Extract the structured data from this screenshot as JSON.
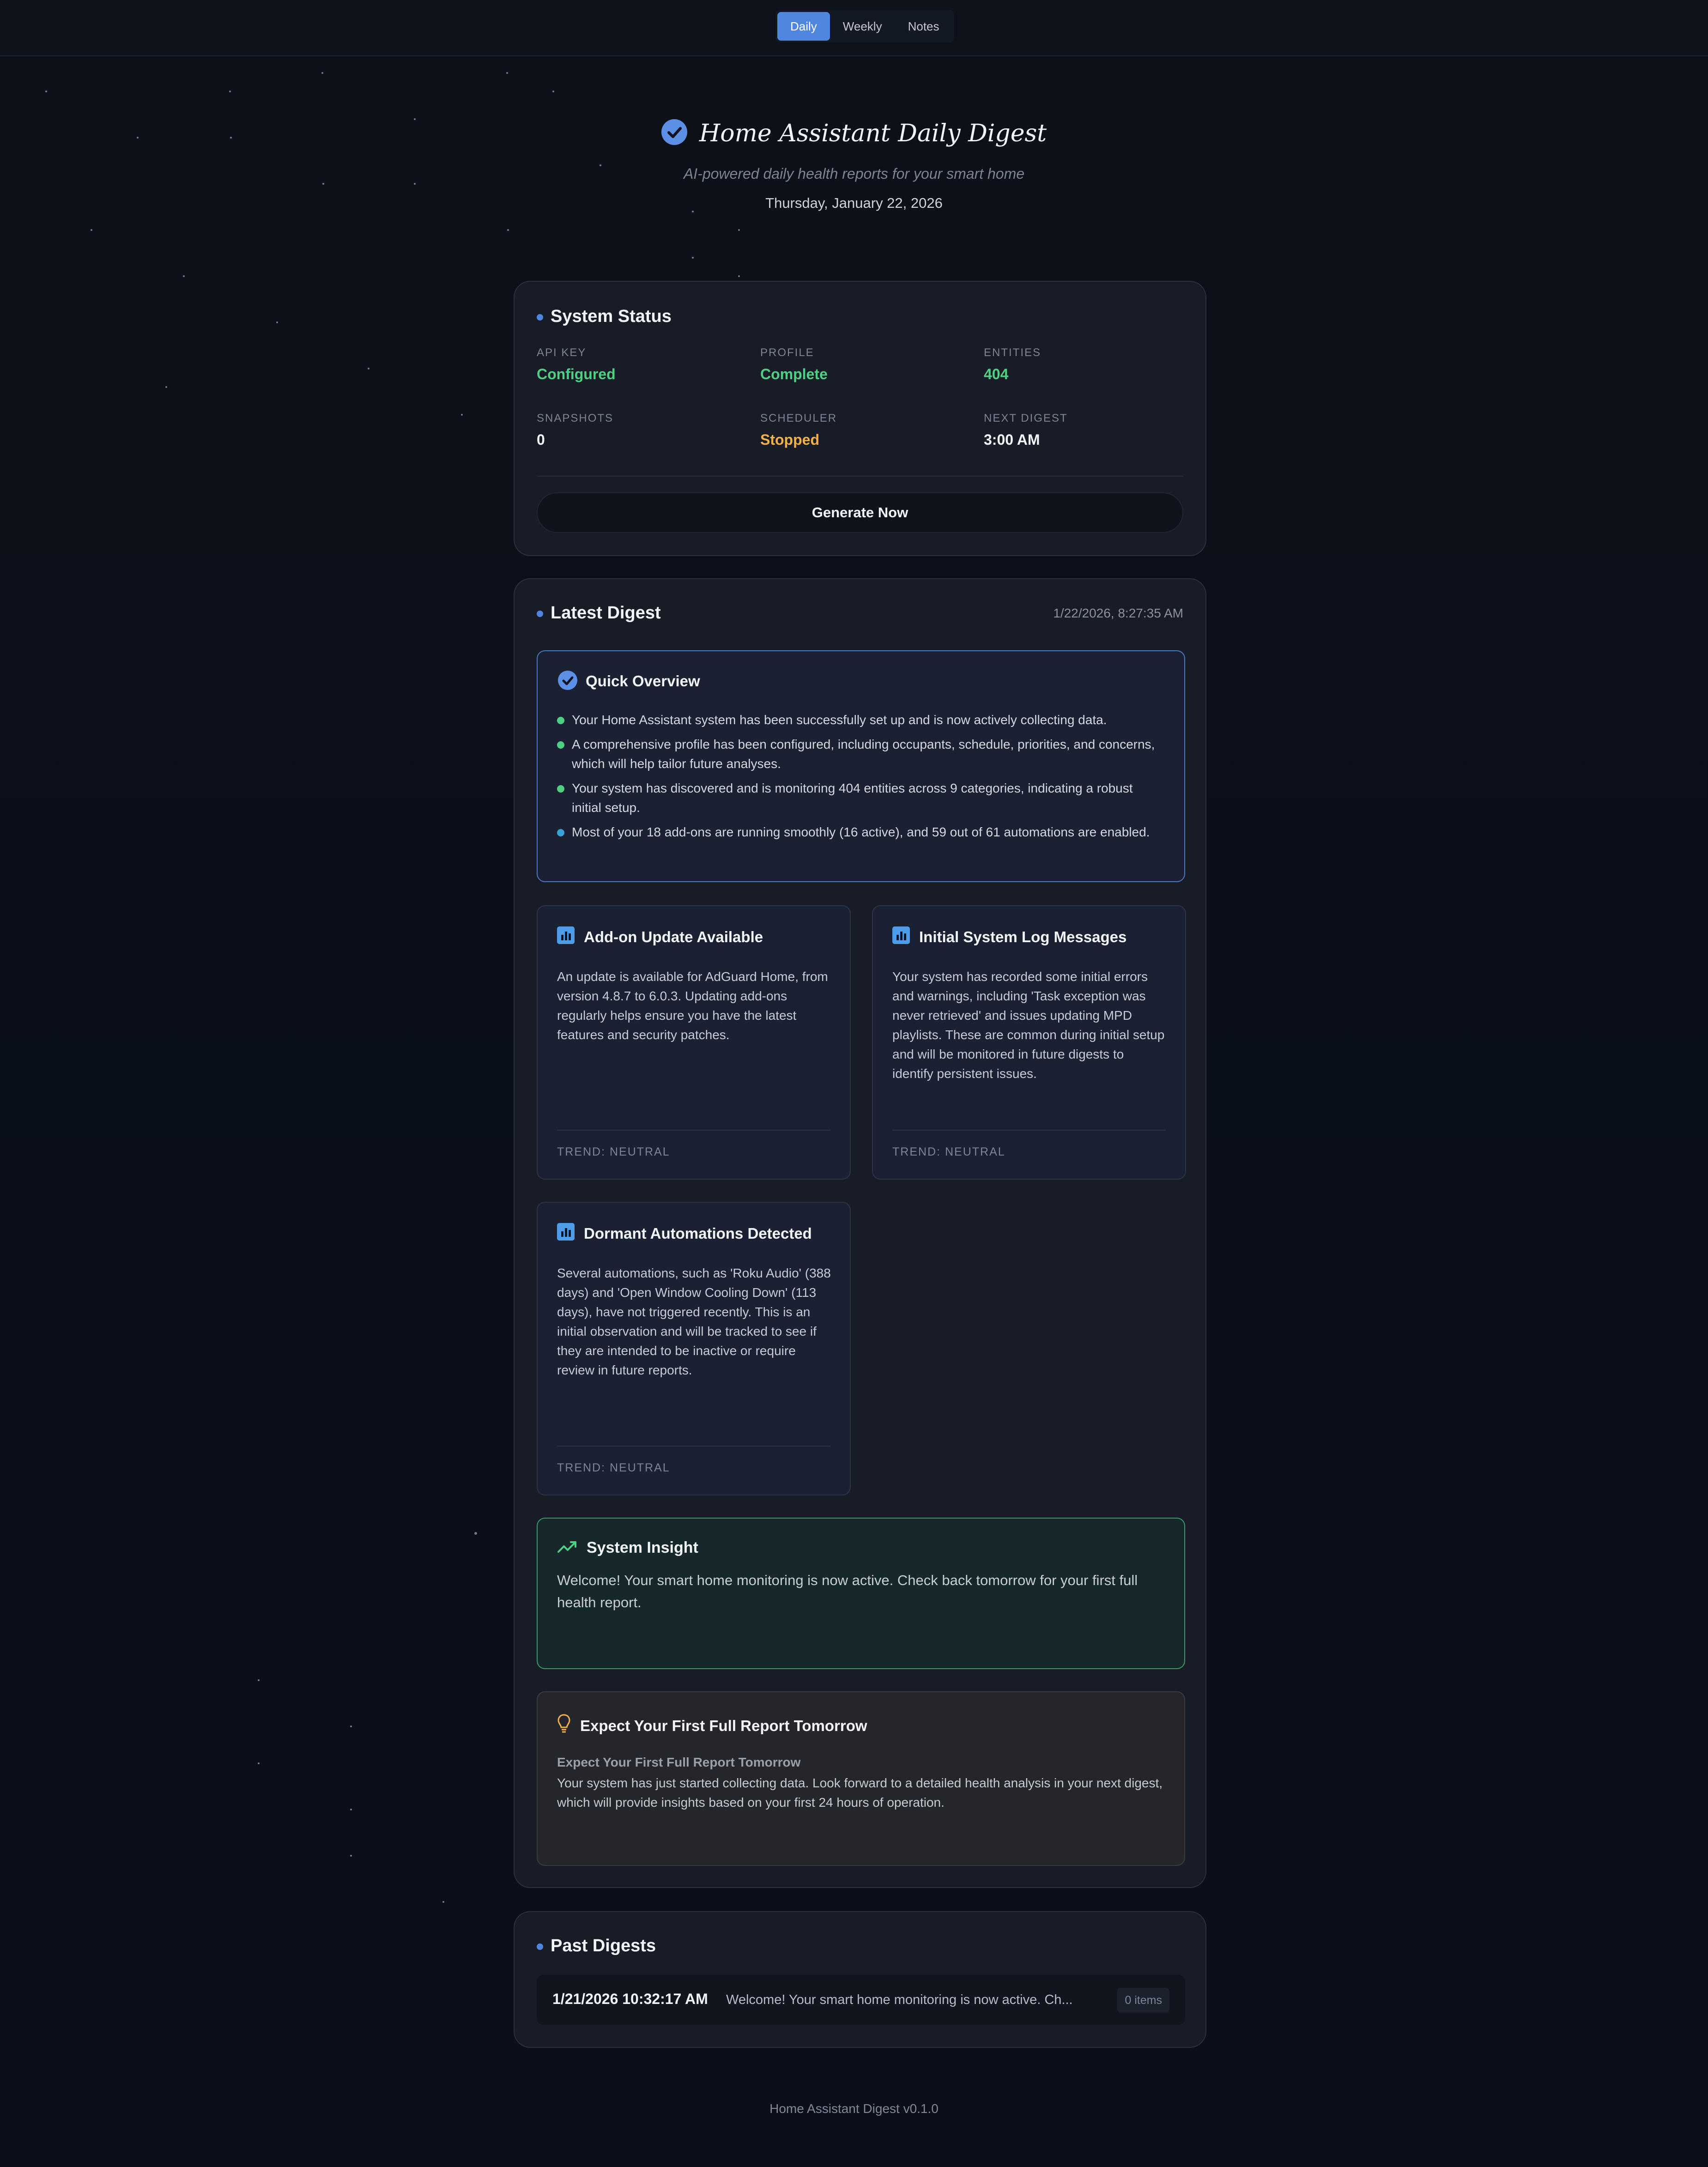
{
  "nav": {
    "tabs": [
      {
        "label": "Daily",
        "active": true
      },
      {
        "label": "Weekly",
        "active": false
      },
      {
        "label": "Notes",
        "active": false
      }
    ]
  },
  "header": {
    "title": "Home Assistant Daily Digest",
    "subtitle": "AI-powered daily health reports for your smart home",
    "date": "Thursday, January 22, 2026"
  },
  "system_status": {
    "title": "System Status",
    "stats": [
      {
        "label": "API KEY",
        "value": "Configured",
        "tone": "green"
      },
      {
        "label": "PROFILE",
        "value": "Complete",
        "tone": "green"
      },
      {
        "label": "ENTITIES",
        "value": "404",
        "tone": "green"
      },
      {
        "label": "SNAPSHOTS",
        "value": "0",
        "tone": "white"
      },
      {
        "label": "SCHEDULER",
        "value": "Stopped",
        "tone": "orange"
      },
      {
        "label": "NEXT DIGEST",
        "value": "3:00 AM",
        "tone": "white"
      }
    ],
    "generate_button": "Generate Now"
  },
  "latest_digest": {
    "title": "Latest Digest",
    "timestamp": "1/22/2026, 8:27:35 AM",
    "quick_overview": {
      "title": "Quick Overview",
      "items": [
        {
          "text": "Your Home Assistant system has been successfully set up and is now actively collecting data.",
          "color": "#4fcf83"
        },
        {
          "text": "A comprehensive profile has been configured, including occupants, schedule, priorities, and concerns, which will help tailor future analyses.",
          "color": "#4fcf83"
        },
        {
          "text": "Your system has discovered and is monitoring 404 entities across 9 categories, indicating a robust initial setup.",
          "color": "#4fcf83"
        },
        {
          "text": "Most of your 18 add-ons are running smoothly (16 active), and 59 out of 61 automations are enabled.",
          "color": "#3aa0d8"
        }
      ]
    },
    "findings": [
      {
        "title": "Add-on Update Available",
        "body": "An update is available for AdGuard Home, from version 4.8.7 to 6.0.3. Updating add-ons regularly helps ensure you have the latest features and security patches.",
        "trend": "TREND: NEUTRAL",
        "icon": "bar-chart-icon"
      },
      {
        "title": "Initial System Log Messages",
        "body": "Your system has recorded some initial errors and warnings, including 'Task exception was never retrieved' and issues updating MPD playlists. These are common during initial setup and will be monitored in future digests to identify persistent issues.",
        "trend": "TREND: NEUTRAL",
        "icon": "bar-chart-icon"
      },
      {
        "title": "Dormant Automations Detected",
        "body": "Several automations, such as 'Roku Audio' (388 days) and 'Open Window Cooling Down' (113 days), have not triggered recently. This is an initial observation and will be tracked to see if they are intended to be inactive or require review in future reports.",
        "trend": "TREND: NEUTRAL",
        "icon": "bar-chart-icon"
      }
    ],
    "insight": {
      "title": "System Insight",
      "body": "Welcome! Your smart home monitoring is now active. Check back tomorrow for your first full health report."
    },
    "recommendation": {
      "title": "Expect Your First Full Report Tomorrow",
      "subtitle": "Expect Your First Full Report Tomorrow",
      "body": "Your system has just started collecting data. Look forward to a detailed health analysis in your next digest, which will provide insights based on your first 24 hours of operation."
    }
  },
  "past_digests": {
    "title": "Past Digests",
    "items": [
      {
        "date": "1/21/2026 10:32:17 AM",
        "summary": "Welcome! Your smart home monitoring is now active. Ch...",
        "badge": "0 items"
      }
    ]
  },
  "footer": {
    "text": "Home Assistant Digest v0.1.0"
  },
  "colors": {
    "accent": "#4f86e0",
    "success": "#4fcf83",
    "warning": "#f0b04a"
  }
}
